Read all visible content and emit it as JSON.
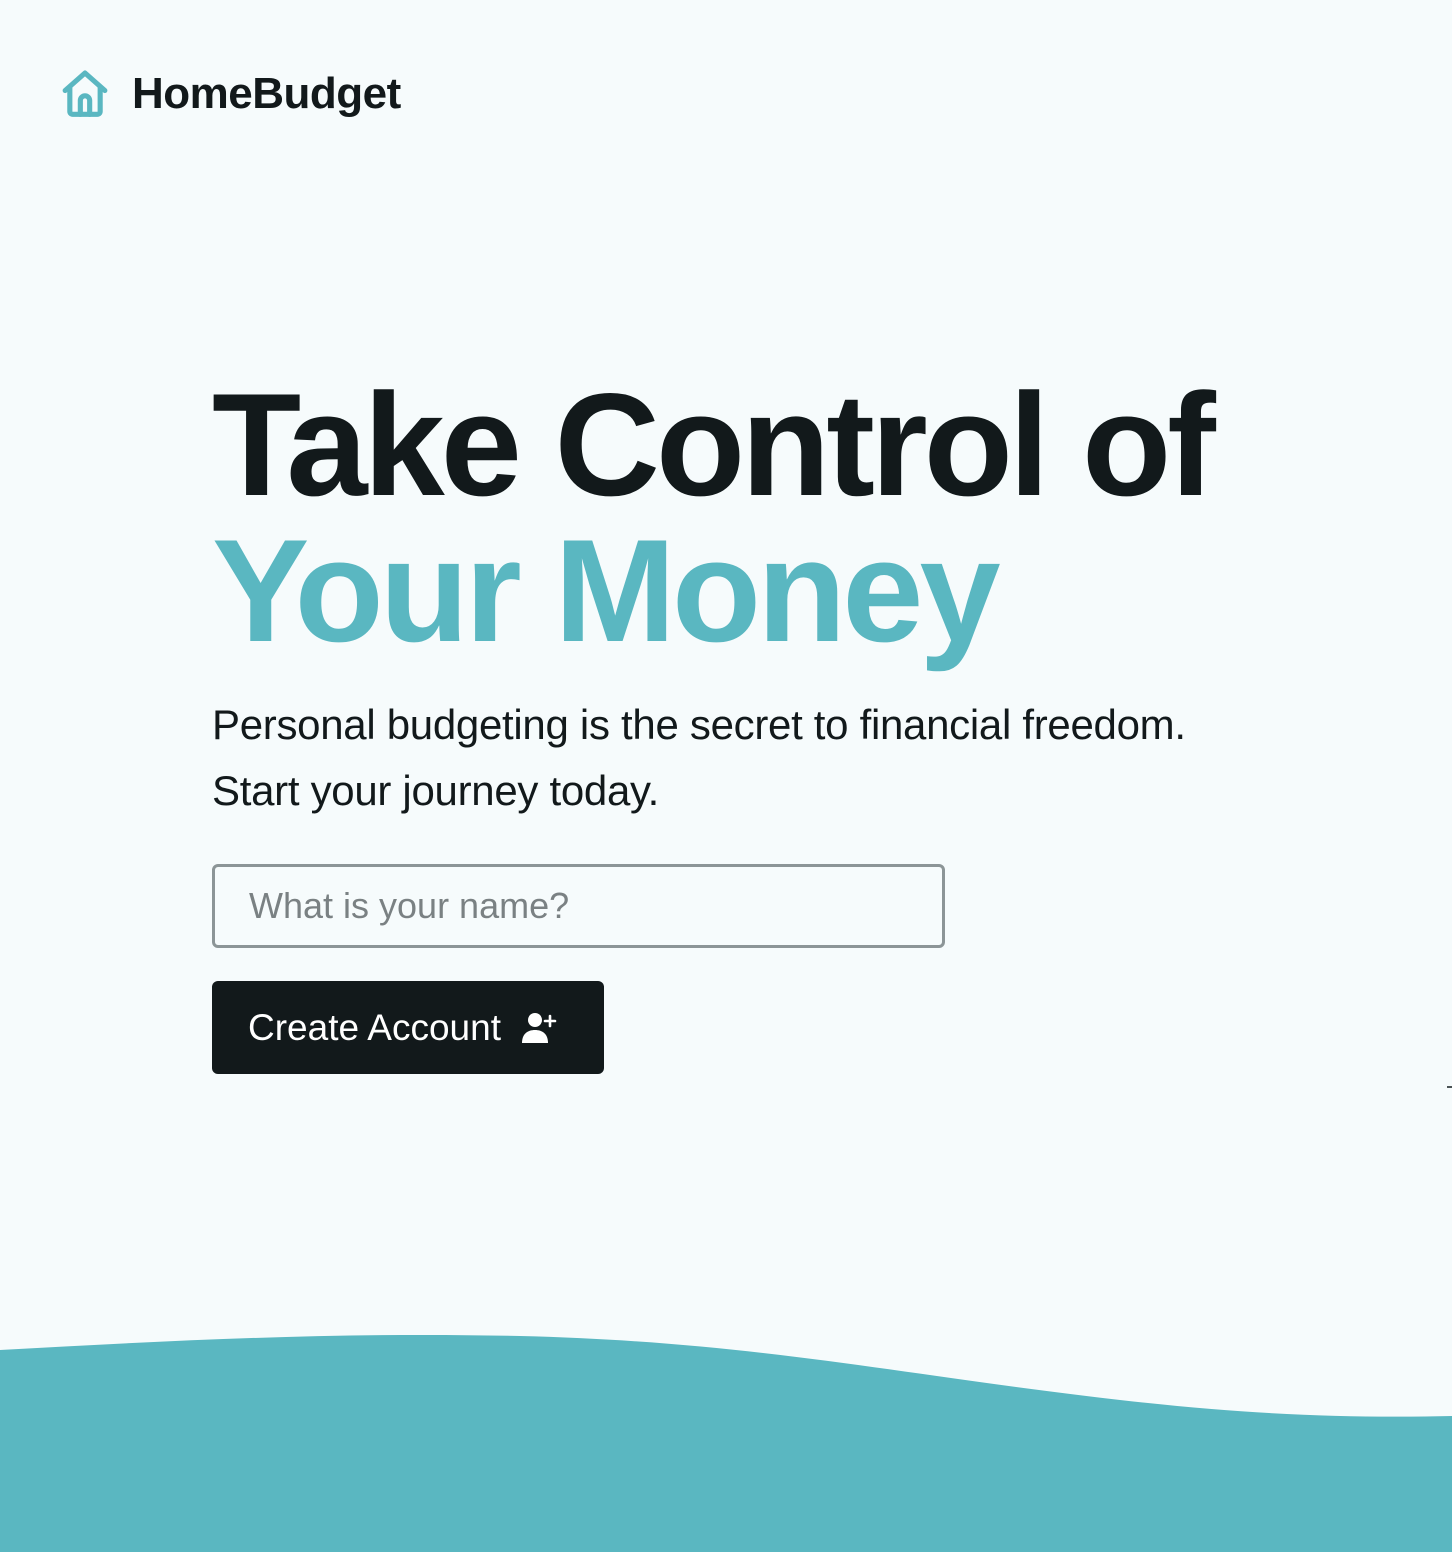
{
  "app": {
    "brand": "HomeBudget",
    "logo_icon": "home-icon",
    "accent_color": "#5ab7c1",
    "text_color": "#12191b",
    "background_color": "#f6fbfc"
  },
  "hero": {
    "headline_line1": "Take Control of",
    "headline_accent": "Your Money",
    "subtitle_line1": "Personal budgeting is the secret to financial freedom.",
    "subtitle_line2": "Start your journey today."
  },
  "form": {
    "name_placeholder": "What is your name?",
    "name_value": "",
    "submit_label": "Create Account",
    "submit_icon": "user-plus-icon"
  }
}
